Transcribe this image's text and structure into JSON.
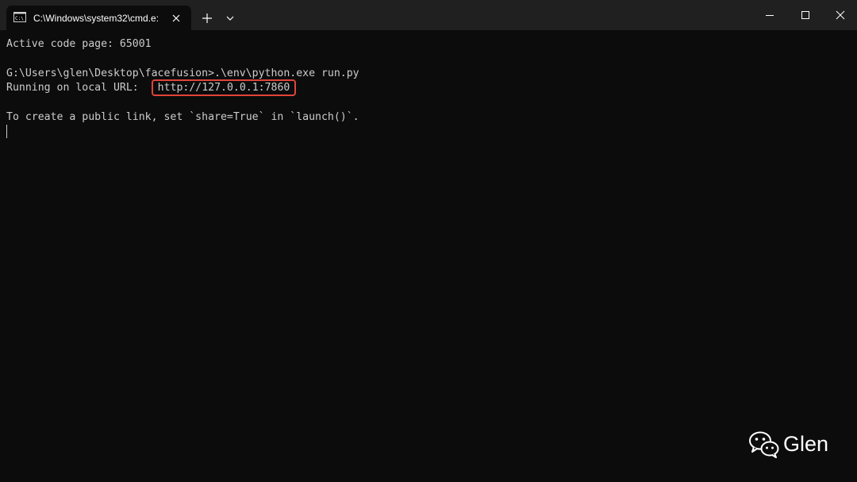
{
  "tab": {
    "title": "C:\\Windows\\system32\\cmd.e:",
    "icon": "cmd-icon"
  },
  "titlebar_icons": [
    "plus-icon",
    "chevron-down-icon",
    "minimize-icon",
    "maximize-icon",
    "close-icon"
  ],
  "console": {
    "lines": [
      "Active code page: 65001",
      "",
      "G:\\Users\\glen\\Desktop\\facefusion>.\\env\\python.exe run.py",
      "Running on local URL:  ",
      "",
      "To create a public link, set `share=True` in `launch()`."
    ],
    "url": "http://127.0.0.1:7860",
    "highlight_color": "#e0443a"
  },
  "watermark": {
    "text": "Glen",
    "icon": "wechat-icon"
  },
  "colors": {
    "background": "#0c0c0c",
    "titlebar": "#202020",
    "text": "#cccccc"
  }
}
